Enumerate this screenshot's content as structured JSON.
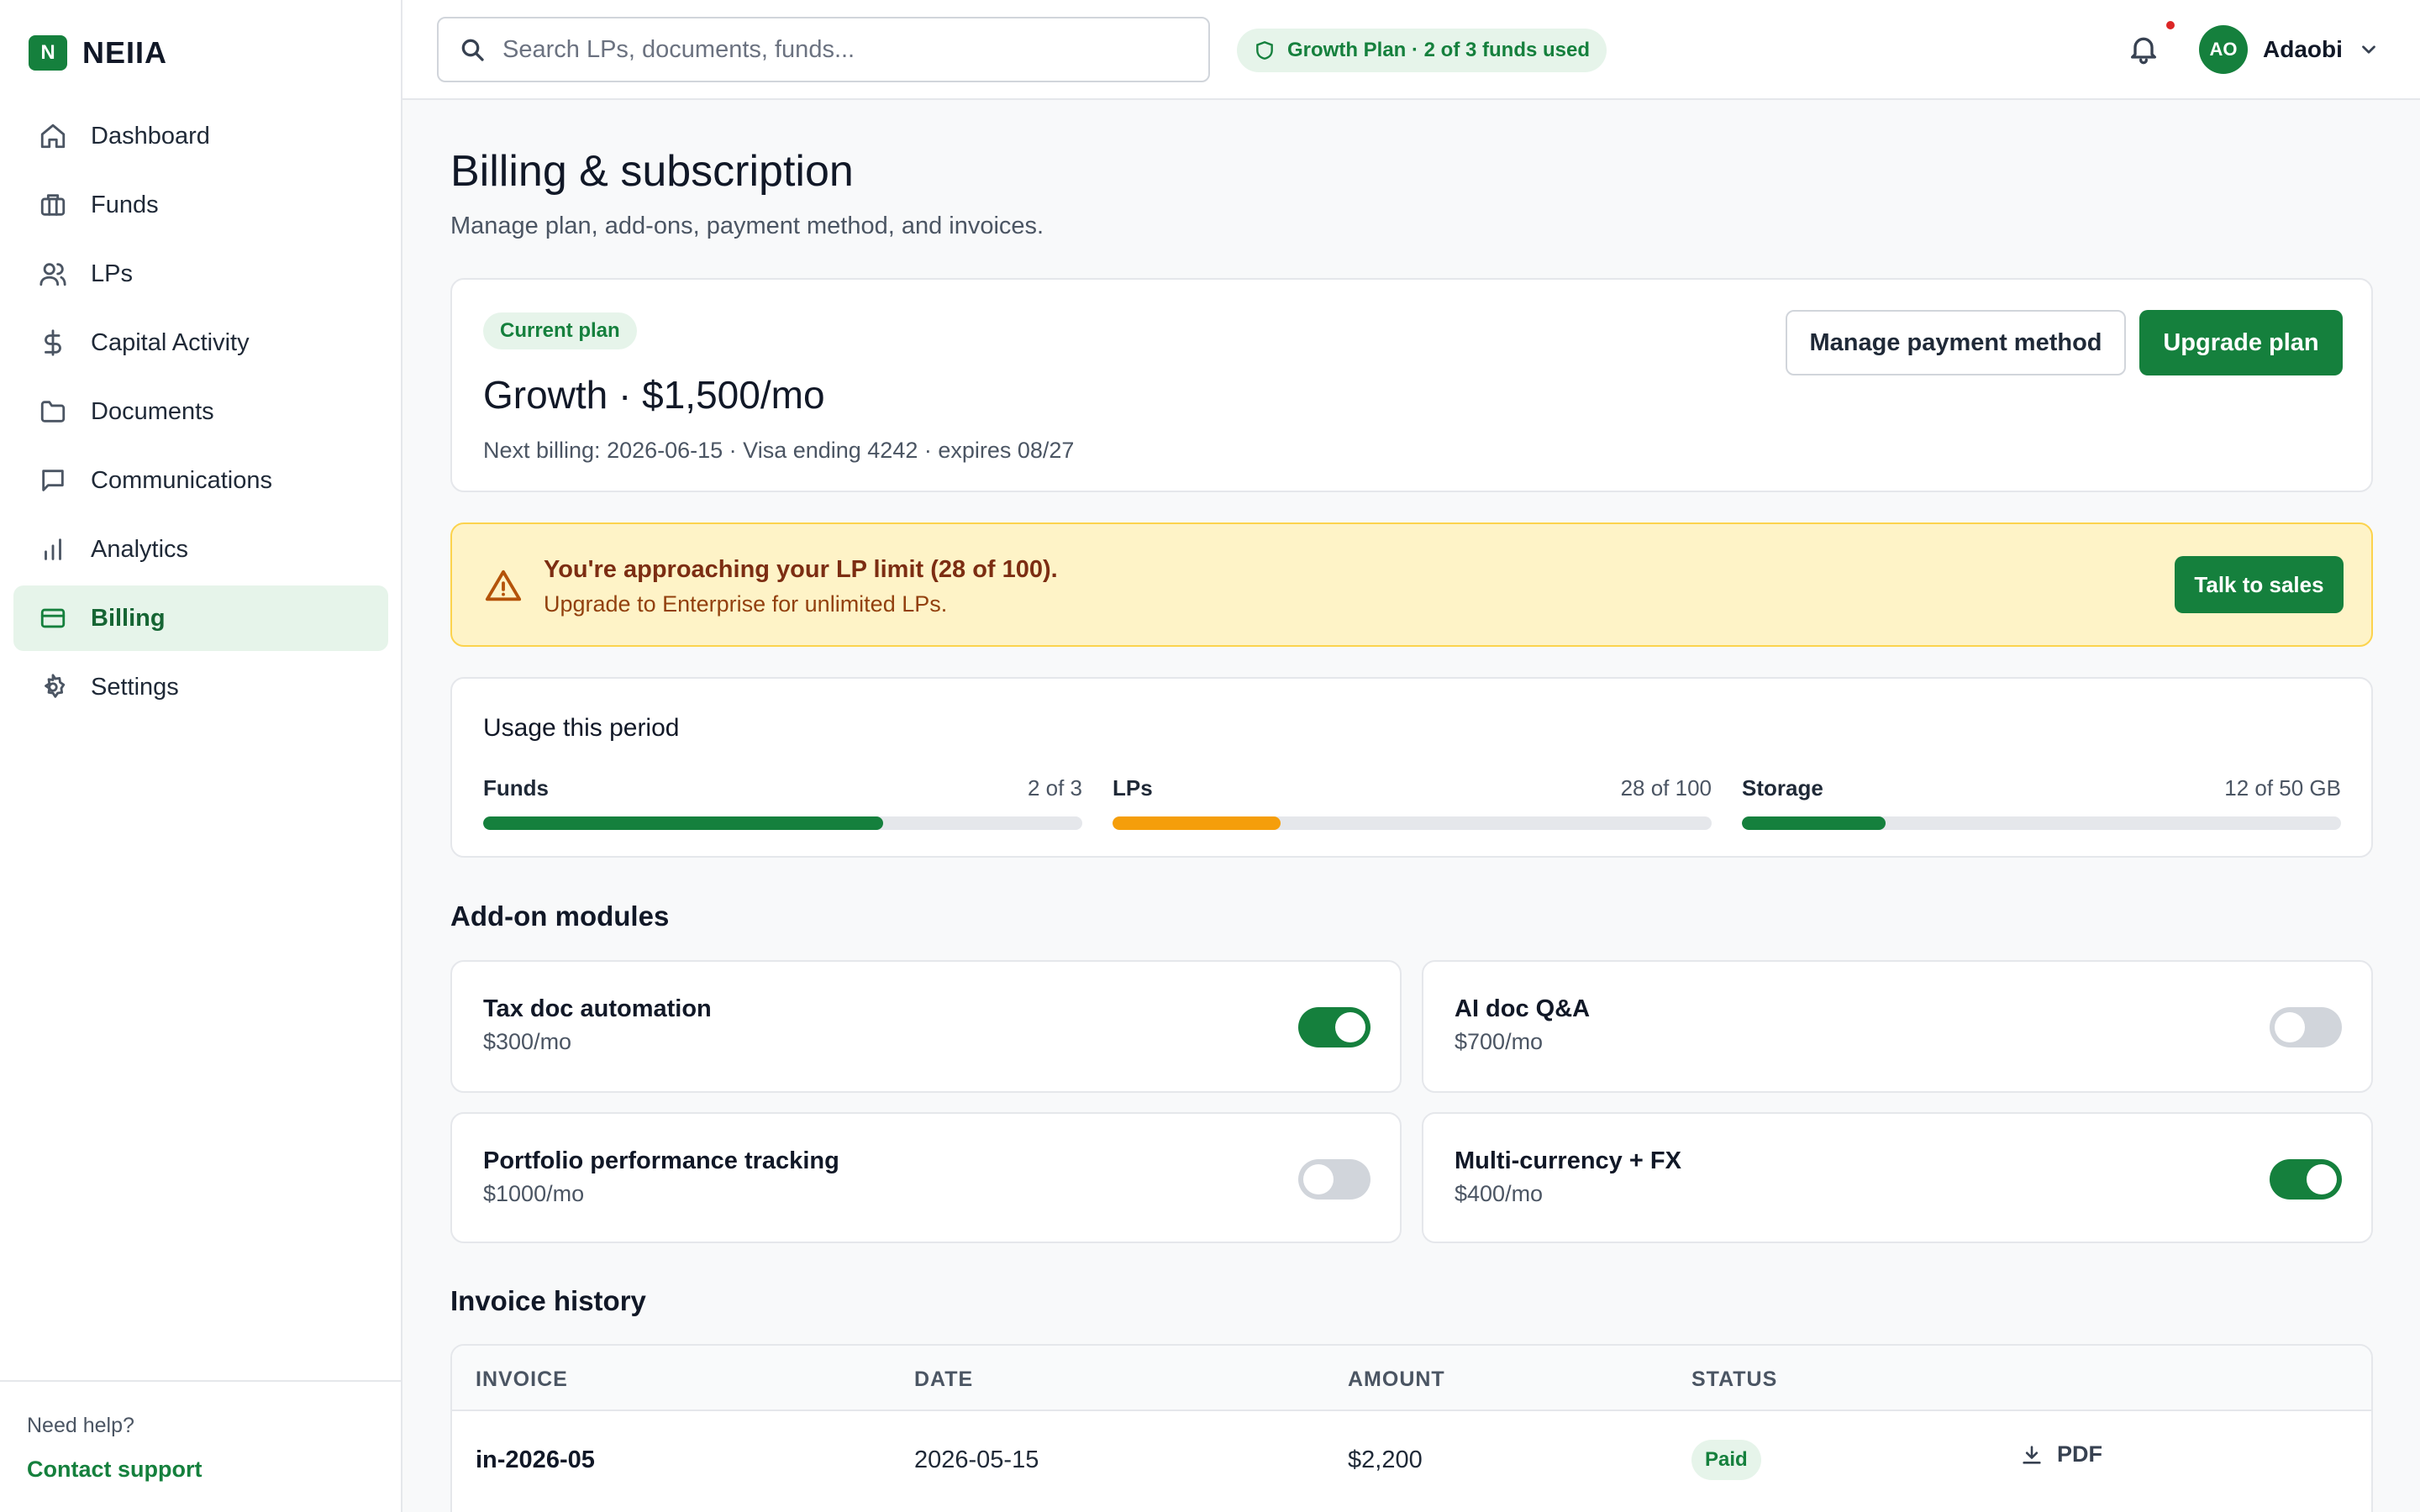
{
  "brand": {
    "logo_letter": "N",
    "name": "NEIIA"
  },
  "sidebar": {
    "items": [
      {
        "label": "Dashboard",
        "icon": "home-icon"
      },
      {
        "label": "Funds",
        "icon": "briefcase-icon"
      },
      {
        "label": "LPs",
        "icon": "users-icon"
      },
      {
        "label": "Capital Activity",
        "icon": "dollar-icon"
      },
      {
        "label": "Documents",
        "icon": "folder-icon"
      },
      {
        "label": "Communications",
        "icon": "message-icon"
      },
      {
        "label": "Analytics",
        "icon": "bar-chart-icon"
      },
      {
        "label": "Billing",
        "icon": "credit-card-icon",
        "active": true
      },
      {
        "label": "Settings",
        "icon": "gear-icon"
      }
    ],
    "footer": {
      "help_text": "Need help?",
      "support_link": "Contact support"
    }
  },
  "topbar": {
    "search_placeholder": "Search LPs, documents, funds...",
    "plan_pill": "Growth Plan · 2 of 3 funds used",
    "user": {
      "initials": "AO",
      "name": "Adaobi"
    }
  },
  "page": {
    "title": "Billing & subscription",
    "subtitle": "Manage plan, add-ons, payment method, and invoices."
  },
  "plan": {
    "badge": "Current plan",
    "name": "Growth · $1,500/mo",
    "meta": "Next billing: 2026-06-15 · Visa ending 4242 · expires 08/27",
    "manage_button": "Manage payment method",
    "upgrade_button": "Upgrade plan"
  },
  "alert": {
    "title": "You're approaching your LP limit (28 of 100).",
    "text": "Upgrade to Enterprise for unlimited LPs.",
    "button": "Talk to sales"
  },
  "usage": {
    "title": "Usage this period",
    "meters": [
      {
        "label": "Funds",
        "value": "2 of 3",
        "fraction": 0.667,
        "color": "#15803d"
      },
      {
        "label": "LPs",
        "value": "28 of 100",
        "fraction": 0.28,
        "color": "#f59e0b"
      },
      {
        "label": "Storage",
        "value": "12 of 50 GB",
        "fraction": 0.24,
        "color": "#15803d"
      }
    ]
  },
  "addons": {
    "title": "Add-on modules",
    "items": [
      {
        "name": "Tax doc automation",
        "price": "$300/mo",
        "enabled": true
      },
      {
        "name": "AI doc Q&A",
        "price": "$700/mo",
        "enabled": false
      },
      {
        "name": "Portfolio performance tracking",
        "price": "$1000/mo",
        "enabled": false
      },
      {
        "name": "Multi-currency + FX",
        "price": "$400/mo",
        "enabled": true
      }
    ]
  },
  "invoices": {
    "title": "Invoice history",
    "columns": [
      "INVOICE",
      "DATE",
      "AMOUNT",
      "STATUS"
    ],
    "rows": [
      {
        "id": "in-2026-05",
        "date": "2026-05-15",
        "amount": "$2,200",
        "status": "Paid",
        "download": "PDF"
      }
    ]
  },
  "colors": {
    "accent": "#15803d",
    "warning": "#f59e0b",
    "alert_bg": "#fef3c7"
  }
}
